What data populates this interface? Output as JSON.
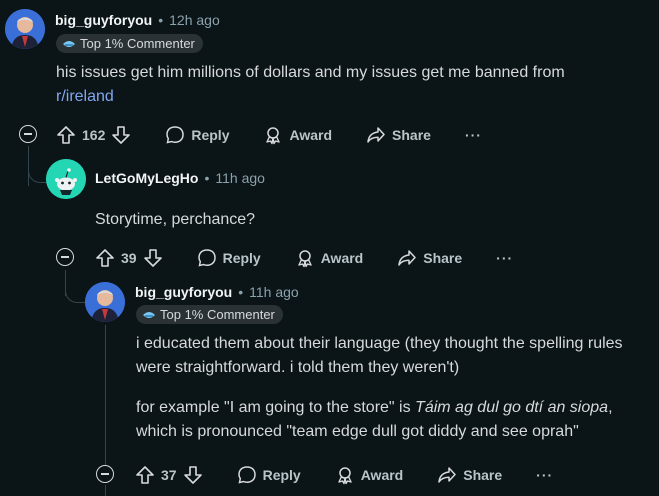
{
  "comments": [
    {
      "username": "big_guyforyou",
      "time": "12h ago",
      "flair": "Top 1% Commenter",
      "body_text": "his issues get him millions of dollars and my issues get me banned from",
      "body_link": "r/ireland",
      "votes": "162",
      "reply": "Reply",
      "award": "Award",
      "share": "Share",
      "more": "···"
    },
    {
      "username": "LetGoMyLegHo",
      "time": "11h ago",
      "body_text": "Storytime, perchance?",
      "votes": "39",
      "reply": "Reply",
      "award": "Award",
      "share": "Share",
      "more": "···"
    },
    {
      "username": "big_guyforyou",
      "time": "11h ago",
      "flair": "Top 1% Commenter",
      "para1": "i educated them about their language (they thought the spelling rules were straightforward. i told them they weren't)",
      "para2_pre": "for example \"I am going to the store\" is ",
      "para2_italic": "Táim ag dul go dtí an siopa",
      "para2_post": ", which is pronounced \"team edge dull got diddy and see oprah\"",
      "votes": "37",
      "reply": "Reply",
      "award": "Award",
      "share": "Share",
      "more": "···"
    }
  ],
  "colors": {
    "background": "#0b1416",
    "text": "#d7dadc",
    "meta": "#8ba2ad",
    "link": "#82a6f0",
    "snoo_bg": "#24d6b3"
  }
}
